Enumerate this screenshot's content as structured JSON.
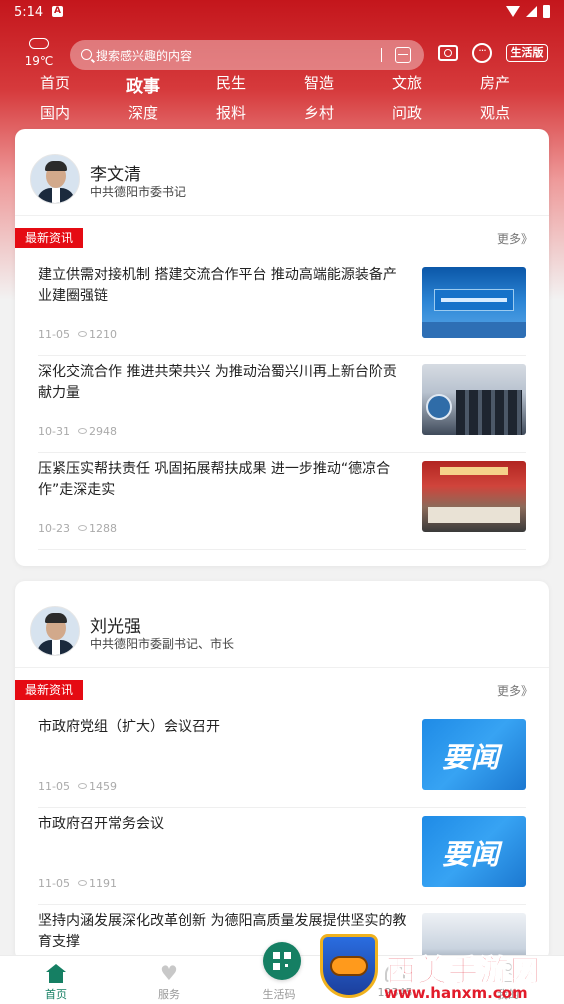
{
  "status_bar": {
    "time": "5:14",
    "notif": "A"
  },
  "header": {
    "temperature": "19℃",
    "search_placeholder": "搜索感兴趣的内容",
    "mode_badge": "生活版",
    "nav_row1": [
      "首页",
      "政事",
      "民生",
      "智造",
      "文旅",
      "房产"
    ],
    "nav_row2": [
      "国内",
      "深度",
      "报料",
      "乡村",
      "问政",
      "观点"
    ],
    "active_nav": "政事"
  },
  "cards": [
    {
      "name": "李文清",
      "title": "中共德阳市委书记",
      "tag": "最新资讯",
      "more": "更多》",
      "news": [
        {
          "title": "建立供需对接机制 搭建交流合作平台 推动高端能源装备产业建圈强链",
          "date": "11-05",
          "views": "1210",
          "thumb": "blue-stage"
        },
        {
          "title": "深化交流合作 推进共荣共兴 为推动治蜀兴川再上新台阶贡献力量",
          "date": "10-31",
          "views": "2948",
          "thumb": "meeting"
        },
        {
          "title": "压紧压实帮扶责任 巩固拓展帮扶成果 进一步推动“德凉合作”走深走实",
          "date": "10-23",
          "views": "1288",
          "thumb": "conference"
        }
      ]
    },
    {
      "name": "刘光强",
      "title": "中共德阳市委副书记、市长",
      "tag": "最新资讯",
      "more": "更多》",
      "news": [
        {
          "title": "市政府党组（扩大）会议召开",
          "date": "11-05",
          "views": "1459",
          "thumb": "要闻"
        },
        {
          "title": "市政府召开常务会议",
          "date": "11-05",
          "views": "1191",
          "thumb": "要闻"
        },
        {
          "title": "坚持内涵发展深化改革创新 为德阳高质量发展提供坚实的教育支撑",
          "date": "",
          "views": "",
          "thumb": "office"
        }
      ]
    }
  ],
  "tabbar": [
    {
      "label": "首页",
      "icon": "home-icon",
      "active": true
    },
    {
      "label": "服务",
      "icon": "heart-icon"
    },
    {
      "label": "生活码",
      "icon": "qr-code-icon"
    },
    {
      "label": "12345",
      "icon": "phone-icon"
    },
    {
      "label": "我的",
      "icon": "person-icon"
    }
  ],
  "watermark": {
    "text": "西美手游网",
    "url": "www.hanxm.com"
  },
  "colors": {
    "brand_red": "#c4161c",
    "tag_red": "#e50b13",
    "accent_green": "#157f63"
  }
}
